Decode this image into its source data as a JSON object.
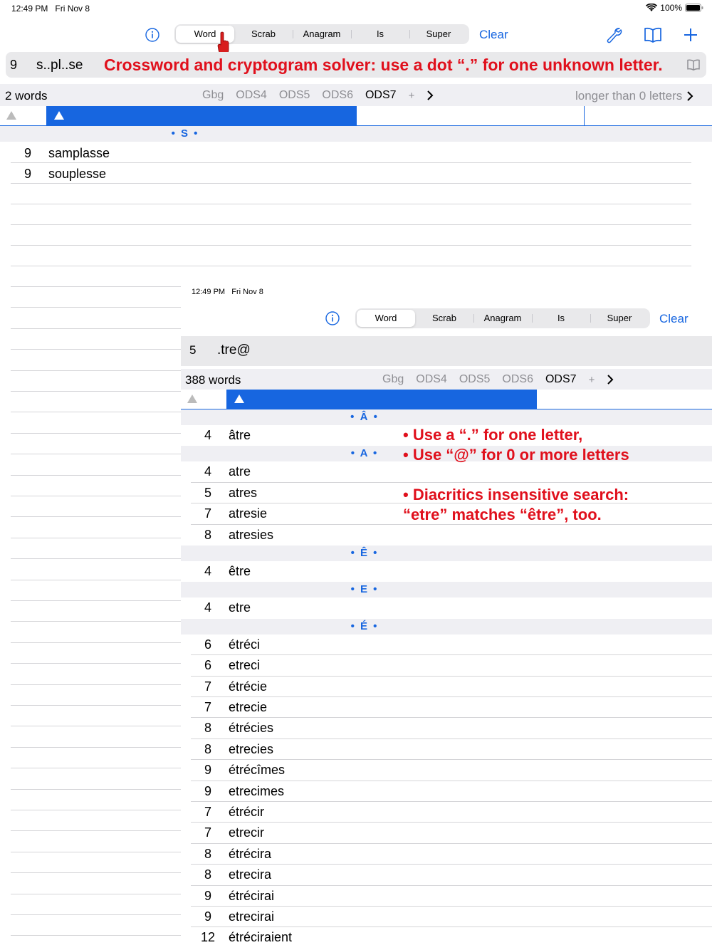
{
  "status": {
    "time": "12:49 PM",
    "date": "Fri Nov 8",
    "battery": "100%"
  },
  "toolbar": {
    "segments": [
      "Word",
      "Scrab",
      "Anagram",
      "Is",
      "Super"
    ],
    "selected": "Word",
    "clear_label": "Clear"
  },
  "search": {
    "length": "9",
    "query": "s..pl..se"
  },
  "banner": "Crossword and cryptogram  solver: use a dot “.” for one unknown letter.",
  "results_bar": {
    "count": "2 words",
    "dicts": [
      "Gbg",
      "ODS4",
      "ODS5",
      "ODS6",
      "ODS7"
    ],
    "active_dict": "ODS7",
    "plus": "+",
    "filter": "longer than 0 letters"
  },
  "list1": {
    "section": "• S •",
    "rows": [
      {
        "n": "9",
        "w": "samplasse"
      },
      {
        "n": "9",
        "w": "souplesse"
      }
    ]
  },
  "second": {
    "status": {
      "time": "12:49 PM",
      "date": "Fri Nov 8"
    },
    "clear_label": "Clear",
    "search": {
      "length": "5",
      "query": ".tre@"
    },
    "count": "388 words",
    "sections": {
      "s1": "• Â •",
      "s2": "• A •",
      "s3": "• Ê •",
      "s4": "• E •",
      "s5": "• É •"
    },
    "rows_a": [
      {
        "n": "4",
        "w": "âtre"
      }
    ],
    "rows_b": [
      {
        "n": "4",
        "w": "atre"
      },
      {
        "n": "5",
        "w": "atres"
      },
      {
        "n": "7",
        "w": "atresie"
      },
      {
        "n": "8",
        "w": "atresies"
      }
    ],
    "rows_c": [
      {
        "n": "4",
        "w": "être"
      }
    ],
    "rows_d": [
      {
        "n": "4",
        "w": "etre"
      }
    ],
    "rows_e": [
      {
        "n": "6",
        "w": "étréci"
      },
      {
        "n": "6",
        "w": "etreci"
      },
      {
        "n": "7",
        "w": "étrécie"
      },
      {
        "n": "7",
        "w": "etrecie"
      },
      {
        "n": "8",
        "w": "étrécies"
      },
      {
        "n": "8",
        "w": "etrecies"
      },
      {
        "n": "9",
        "w": "étrécîmes"
      },
      {
        "n": "9",
        "w": "etrecimes"
      },
      {
        "n": "7",
        "w": "étrécir"
      },
      {
        "n": "7",
        "w": "etrecir"
      },
      {
        "n": "8",
        "w": "étrécira"
      },
      {
        "n": "8",
        "w": "etrecira"
      },
      {
        "n": "9",
        "w": "étrécirai"
      },
      {
        "n": "9",
        "w": "etrecirai"
      },
      {
        "n": "12",
        "w": "étréciraient"
      }
    ]
  },
  "notes": {
    "n1": "• Use a “.” for one letter,",
    "n2": "• Use “@” for 0 or more letters",
    "n3": "• Diacritics insensitive search:",
    "n4": "“etre” matches “être”, too."
  },
  "colors": {
    "accent": "#1766e0",
    "annotation": "#e0101c"
  }
}
